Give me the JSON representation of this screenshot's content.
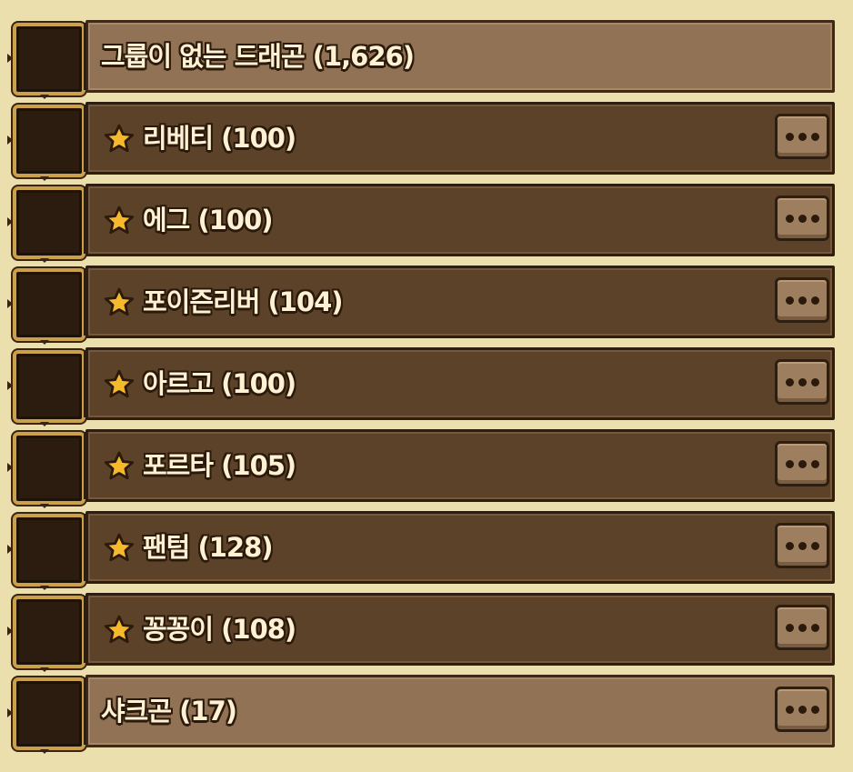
{
  "groups": [
    {
      "label": "그룹이 없는 드래곤 (1,626)",
      "starred": false,
      "has_more": false,
      "style": "light"
    },
    {
      "label": "리베티 (100)",
      "starred": true,
      "has_more": true,
      "style": "dark"
    },
    {
      "label": "에그 (100)",
      "starred": true,
      "has_more": true,
      "style": "dark"
    },
    {
      "label": "포이즌리버 (104)",
      "starred": true,
      "has_more": true,
      "style": "dark"
    },
    {
      "label": "아르고 (100)",
      "starred": true,
      "has_more": true,
      "style": "dark"
    },
    {
      "label": "포르타 (105)",
      "starred": true,
      "has_more": true,
      "style": "dark"
    },
    {
      "label": "팬텀 (128)",
      "starred": true,
      "has_more": true,
      "style": "dark"
    },
    {
      "label": "꽁꽁이 (108)",
      "starred": true,
      "has_more": true,
      "style": "dark"
    },
    {
      "label": "샤크곤 (17)",
      "starred": false,
      "has_more": true,
      "style": "light"
    }
  ],
  "icons": {
    "star": "star-icon",
    "more": "more-dots-icon"
  },
  "colors": {
    "background": "#ebdfae",
    "bar_dark": "#5c4228",
    "bar_light": "#927254",
    "star": "#f6b92b",
    "checkbox_border": "#caa04a"
  }
}
